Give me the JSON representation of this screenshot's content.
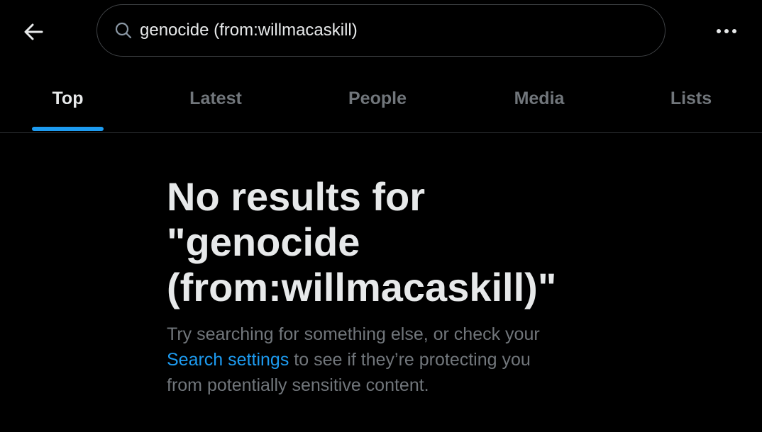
{
  "header": {
    "back_icon": "arrow-left-icon",
    "search": {
      "icon": "search-icon",
      "value": "genocide (from:willmacaskill)"
    },
    "more_icon": "more-horizontal-icon"
  },
  "tabs": [
    {
      "label": "Top",
      "active": true
    },
    {
      "label": "Latest",
      "active": false
    },
    {
      "label": "People",
      "active": false
    },
    {
      "label": "Media",
      "active": false
    },
    {
      "label": "Lists",
      "active": false
    }
  ],
  "empty_state": {
    "title_line1": "No results for",
    "title_line2": "\"genocide",
    "title_line3": "(from:willmacaskill)\"",
    "body_line1": "Try searching for something else, or check your",
    "link_text": "Search settings",
    "body_line2_rest": " to see if they’re protecting you",
    "body_line3": "from potentially sensitive content."
  },
  "colors": {
    "background": "#000000",
    "text_primary": "#e7e9ea",
    "text_secondary": "#71767b",
    "accent": "#1d9bf0",
    "border": "#2f3336"
  }
}
